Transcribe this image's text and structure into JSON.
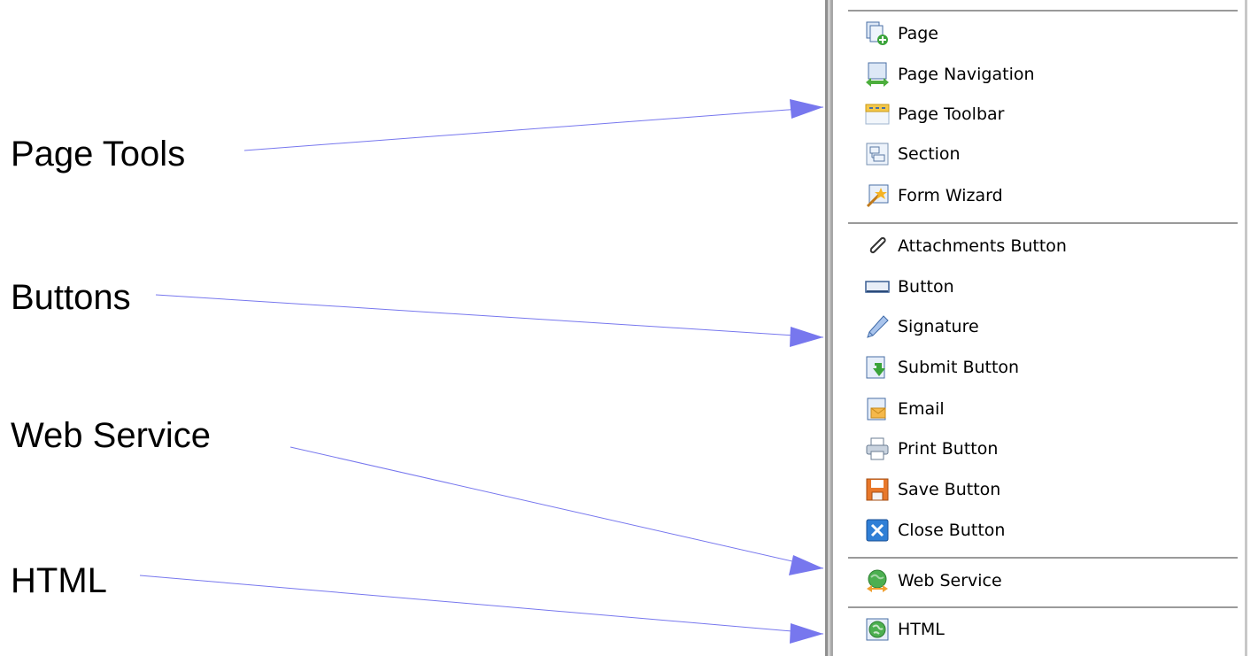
{
  "callouts": {
    "page_tools": "Page Tools",
    "buttons": "Buttons",
    "web_service": "Web Service",
    "html": "HTML"
  },
  "menu": {
    "page_tools": [
      {
        "label": "Page",
        "icon": "page-add-icon"
      },
      {
        "label": "Page Navigation",
        "icon": "page-navigation-icon"
      },
      {
        "label": "Page Toolbar",
        "icon": "page-toolbar-icon"
      },
      {
        "label": "Section",
        "icon": "section-icon"
      },
      {
        "label": "Form Wizard",
        "icon": "form-wizard-icon"
      }
    ],
    "buttons": [
      {
        "label": "Attachments Button",
        "icon": "paperclip-icon"
      },
      {
        "label": "Button",
        "icon": "button-icon"
      },
      {
        "label": "Signature",
        "icon": "pen-icon"
      },
      {
        "label": "Submit Button",
        "icon": "submit-icon"
      },
      {
        "label": "Email",
        "icon": "email-icon"
      },
      {
        "label": "Print Button",
        "icon": "printer-icon"
      },
      {
        "label": "Save Button",
        "icon": "floppy-disk-icon"
      },
      {
        "label": "Close Button",
        "icon": "close-icon"
      }
    ],
    "web_service": [
      {
        "label": "Web Service",
        "icon": "web-service-icon"
      }
    ],
    "html": [
      {
        "label": "HTML",
        "icon": "globe-icon"
      }
    ]
  },
  "colors": {
    "arrow": "#7777ee",
    "separator": "#9a9a9a"
  }
}
